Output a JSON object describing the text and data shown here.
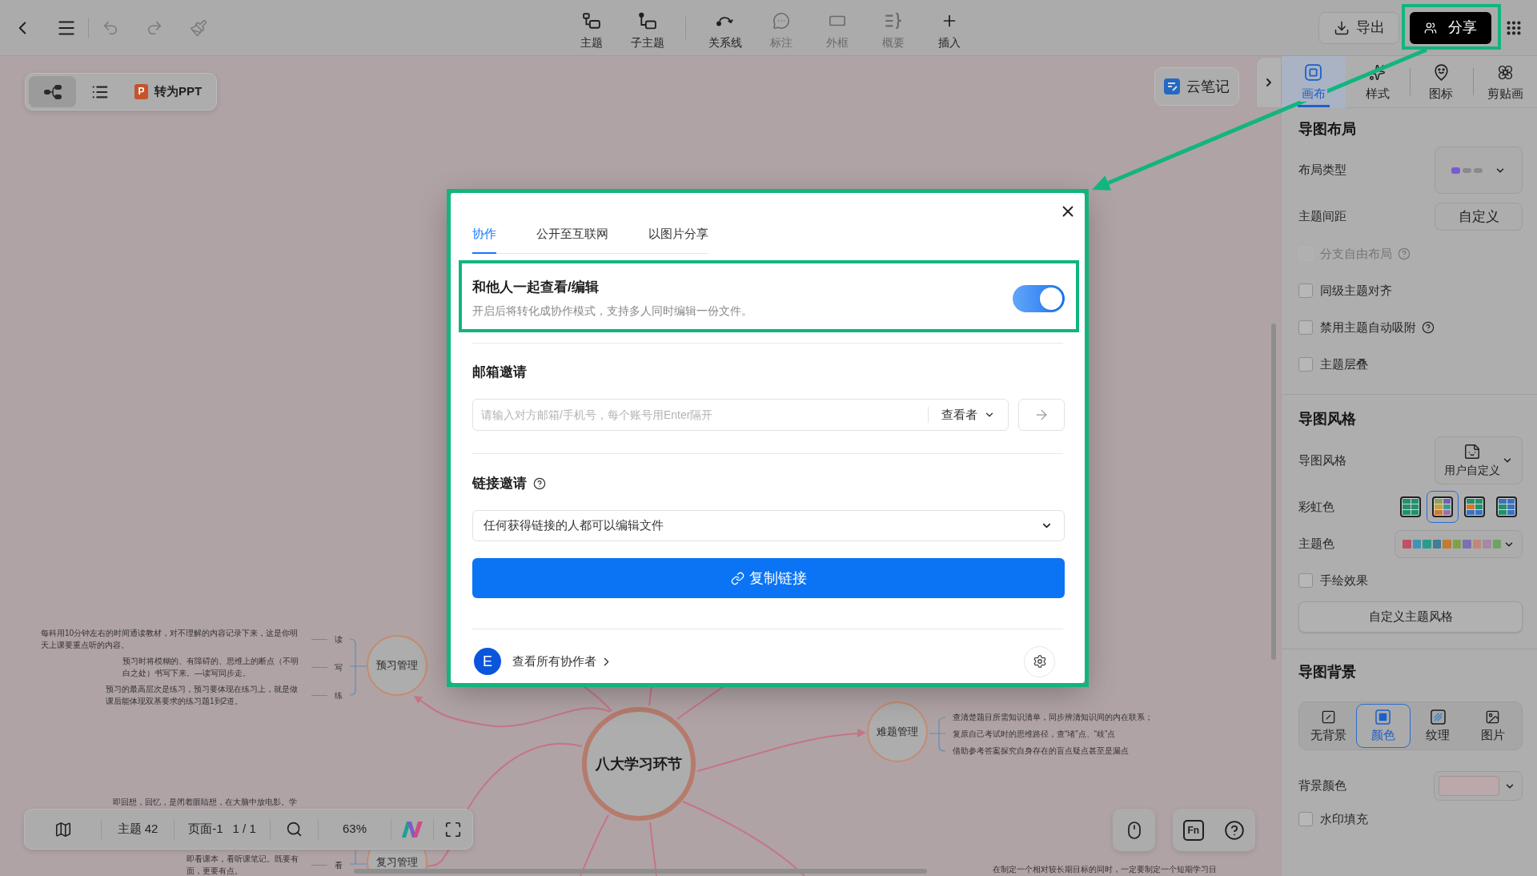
{
  "toolbar": {
    "history_tools": [
      {
        "disabled": true
      },
      {
        "disabled": true
      },
      {
        "disabled": true
      }
    ],
    "tools": [
      {
        "label": "主题",
        "disabled": false
      },
      {
        "label": "子主题",
        "disabled": false
      },
      {
        "label": "关系线",
        "disabled": false
      },
      {
        "label": "标注",
        "disabled": true
      },
      {
        "label": "外框",
        "disabled": true
      },
      {
        "label": "概要",
        "disabled": true
      },
      {
        "label": "插入",
        "disabled": false
      }
    ],
    "export_button": "导出",
    "share_button": "分享"
  },
  "view_switcher": {
    "views": [
      {
        "selected": true
      },
      {
        "selected": false
      }
    ],
    "ppt_logo": "P",
    "ppt_button": "转为PPT"
  },
  "cloud_note_button": "云笔记",
  "mind_map": {
    "central_topic": "八大学习环节",
    "topics": [
      {
        "label": "预习管理",
        "notes": [
          {
            "tag": "读",
            "text": "每科用10分钟左右的时间通读教材，对不理解的内容记录下来，这是你明天上课要重点听的内容。"
          },
          {
            "tag": "写",
            "text": "预习时将模糊的、有障碍的、思维上的断点（不明白之处）书写下来。—读写同步走。"
          },
          {
            "tag": "练",
            "text": "预习的最高层次是练习，预习要体现在练习上，就是做课后能体现双基要求的练习题1到2道。"
          }
        ]
      },
      {
        "label": "难题管理",
        "notes": [
          {
            "text": "查清楚题目所需知识清单，同步辨清知识间的内在联系；"
          },
          {
            "text": "复原自己考试时的思维路径，查“堵”点、“歧”点"
          },
          {
            "text": "借助参考答案探究自身存在的盲点疑点甚至是漏点"
          }
        ]
      },
      {
        "label": "复习管理",
        "notes": [
          {
            "text": "即回想，回忆，是闭着眼睛想，在大脑中放电影。学"
          },
          {
            "tag": "看",
            "text": "即看课本，看听课笔记。既要有面，更要有点。"
          }
        ]
      }
    ],
    "other_notes": [
      "在制定一个相对较长期目标的同时，一定要制定一个短期学习目"
    ]
  },
  "bottom_bar": {
    "topic_count": "主题 42",
    "page": "页面-1",
    "page_count": "1 / 1",
    "zoom": "63%",
    "fn_key": "Fn"
  },
  "side_panel": {
    "tabs": [
      {
        "label": "画布",
        "selected": true
      },
      {
        "label": "样式",
        "selected": false
      },
      {
        "label": "图标",
        "selected": false
      },
      {
        "label": "剪贴画",
        "selected": false
      }
    ],
    "layout": {
      "title": "导图布局",
      "layout_type_label": "布局类型",
      "spacing_label": "主题间距",
      "spacing_button": "自定义",
      "options": [
        {
          "label": "分支自由布局",
          "checked": false,
          "disabled": true,
          "help": true
        },
        {
          "label": "同级主题对齐",
          "checked": false,
          "disabled": false,
          "help": false
        },
        {
          "label": "禁用主题自动吸附",
          "checked": false,
          "disabled": false,
          "help": true
        },
        {
          "label": "主题层叠",
          "checked": false,
          "disabled": false,
          "help": false
        }
      ]
    },
    "style": {
      "title": "导图风格",
      "style_label": "导图风格",
      "style_value": "用户自定义",
      "rainbow_label": "彩虹色",
      "rainbow_options": [
        {
          "selected": false,
          "cells": [
            {
              "color": "#23906f"
            },
            {
              "color": "#23906f"
            },
            {
              "color": "#23906f"
            },
            {
              "color": "#23906f"
            },
            {
              "color": "#23906f"
            },
            {
              "color": "#23906f"
            }
          ]
        },
        {
          "selected": true,
          "cells": [
            {
              "color": "#86a55a"
            },
            {
              "color": "#7a5fb0"
            },
            {
              "color": "#c9a040"
            },
            {
              "color": "#3a9d8f"
            },
            {
              "color": "#c97a3a"
            },
            {
              "color": "#9a70a8"
            }
          ]
        },
        {
          "selected": false,
          "cells": [
            {
              "color": "#23906f"
            },
            {
              "color": "#23906f"
            },
            {
              "color": "#d07a30"
            },
            {
              "color": "#23906f"
            },
            {
              "color": "#3a72c0"
            },
            {
              "color": "#3a72c0"
            }
          ]
        },
        {
          "selected": false,
          "cells": [
            {
              "color": "#3a72c0"
            },
            {
              "color": "#3a72c0"
            },
            {
              "color": "#23906f"
            },
            {
              "color": "#3a72c0"
            },
            {
              "color": "#23906f"
            },
            {
              "color": "#3a72c0"
            }
          ]
        }
      ],
      "theme_color_label": "主题色",
      "theme_colors": [
        {
          "color": "#c0506a"
        },
        {
          "color": "#3f93b8"
        },
        {
          "color": "#2a9c8c"
        },
        {
          "color": "#3e7f9a"
        },
        {
          "color": "#c47a30"
        },
        {
          "color": "#82a04a"
        },
        {
          "color": "#7c70b2"
        },
        {
          "color": "#c08878"
        },
        {
          "color": "#a58aa6"
        },
        {
          "color": "#6ca463"
        }
      ],
      "options": [
        {
          "label": "手绘效果",
          "checked": false,
          "disabled": false,
          "help": false
        }
      ],
      "custom_button": "自定义主题风格"
    },
    "background": {
      "title": "导图背景",
      "types": [
        {
          "label": "无背景",
          "kind": "none",
          "selected": false
        },
        {
          "label": "颜色",
          "kind": "color",
          "selected": true
        },
        {
          "label": "纹理",
          "kind": "texture",
          "selected": false
        },
        {
          "label": "图片",
          "kind": "image",
          "selected": false
        }
      ],
      "color_label": "背景颜色",
      "color": "#bba8ab",
      "options": [
        {
          "label": "水印填充",
          "checked": false,
          "disabled": false,
          "help": false
        }
      ]
    }
  },
  "share_dialog": {
    "tabs": [
      {
        "label": "协作",
        "selected": true
      },
      {
        "label": "公开至互联网",
        "selected": false
      },
      {
        "label": "以图片分享",
        "selected": false
      }
    ],
    "collaboration": {
      "title": "和他人一起查看/编辑",
      "description": "开启后将转化成协作模式，支持多人同时编辑一份文件。",
      "on": true
    },
    "email_invite": {
      "title": "邮箱邀请",
      "placeholder": "请输入对方邮箱/手机号，每个账号用Enter隔开",
      "role": "查看者"
    },
    "link_invite": {
      "title": "链接邀请",
      "permission": "任何获得链接的人都可以编辑文件",
      "copy_button": "复制链接"
    },
    "collaborators": {
      "avatar": "E",
      "link": "查看所有协作者"
    }
  }
}
